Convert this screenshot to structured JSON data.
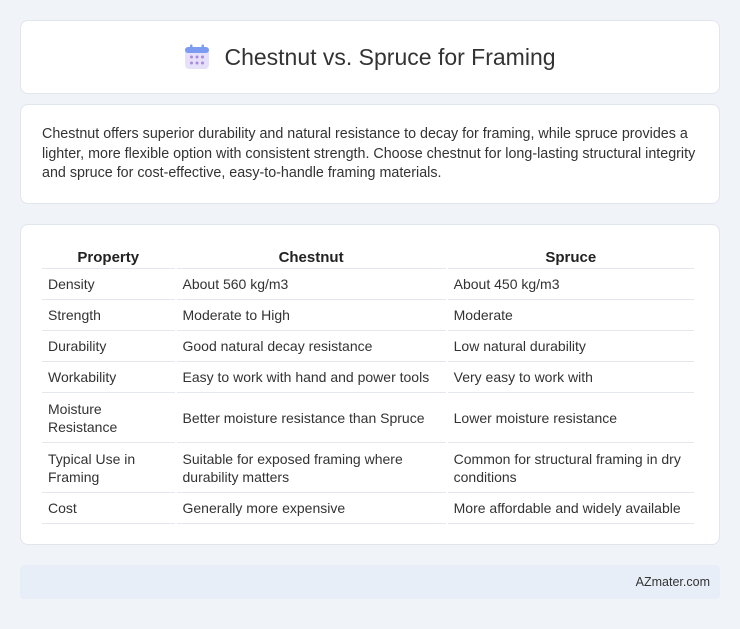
{
  "header": {
    "title": "Chestnut vs. Spruce for Framing",
    "icon": "calendar-icon",
    "icon_colors": {
      "top": "#7b9cf0",
      "body": "#e6e0fb",
      "dots": "#a78bdc"
    }
  },
  "summary": {
    "text": "Chestnut offers superior durability and natural resistance to decay for framing, while spruce provides a lighter, more flexible option with consistent strength. Choose chestnut for long-lasting structural integrity and spruce for cost-effective, easy-to-handle framing materials."
  },
  "table": {
    "headers": [
      "Property",
      "Chestnut",
      "Spruce"
    ],
    "rows": [
      [
        "Density",
        "About 560 kg/m3",
        "About 450 kg/m3"
      ],
      [
        "Strength",
        "Moderate to High",
        "Moderate"
      ],
      [
        "Durability",
        "Good natural decay resistance",
        "Low natural durability"
      ],
      [
        "Workability",
        "Easy to work with hand and power tools",
        "Very easy to work with"
      ],
      [
        "Moisture Resistance",
        "Better moisture resistance than Spruce",
        "Lower moisture resistance"
      ],
      [
        "Typical Use in Framing",
        "Suitable for exposed framing where durability matters",
        "Common for structural framing in dry conditions"
      ],
      [
        "Cost",
        "Generally more expensive",
        "More affordable and widely available"
      ]
    ]
  },
  "footer": {
    "brand": "AZmater.com"
  }
}
